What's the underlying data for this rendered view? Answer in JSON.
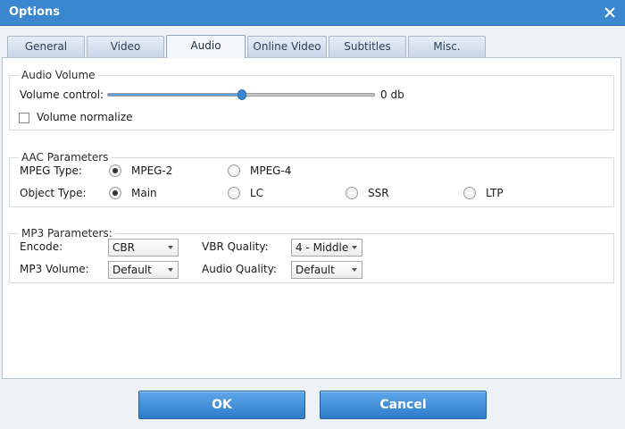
{
  "window": {
    "title": "Options"
  },
  "tabs": [
    {
      "label": "General"
    },
    {
      "label": "Video"
    },
    {
      "label": "Audio"
    },
    {
      "label": "Online Video"
    },
    {
      "label": "Subtitles"
    },
    {
      "label": "Misc."
    }
  ],
  "active_tab": "Audio",
  "audio_volume": {
    "title": "Audio Volume",
    "volume_label": "Volume control:",
    "volume_value": "0 db",
    "volume_level_fraction": 0.5,
    "normalize_label": "Volume normalize",
    "normalize_checked": false
  },
  "aac": {
    "title": "AAC Parameters",
    "mpeg_type_label": "MPEG Type:",
    "mpeg_options": [
      "MPEG-2",
      "MPEG-4"
    ],
    "mpeg_selected": "MPEG-2",
    "object_type_label": "Object Type:",
    "object_options": [
      "Main",
      "LC",
      "SSR",
      "LTP"
    ],
    "object_selected": "Main"
  },
  "mp3": {
    "title": "MP3 Parameters:",
    "encode_label": "Encode:",
    "encode_value": "CBR",
    "vbr_quality_label": "VBR Quality:",
    "vbr_quality_value": "4 - Middle",
    "mp3_volume_label": "MP3 Volume:",
    "mp3_volume_value": "Default",
    "audio_quality_label": "Audio Quality:",
    "audio_quality_value": "Default"
  },
  "buttons": {
    "ok": "OK",
    "cancel": "Cancel"
  },
  "colors": {
    "titlebar": "#3a86cf",
    "button": "#3a86cf",
    "accent": "#5aa3e6"
  }
}
